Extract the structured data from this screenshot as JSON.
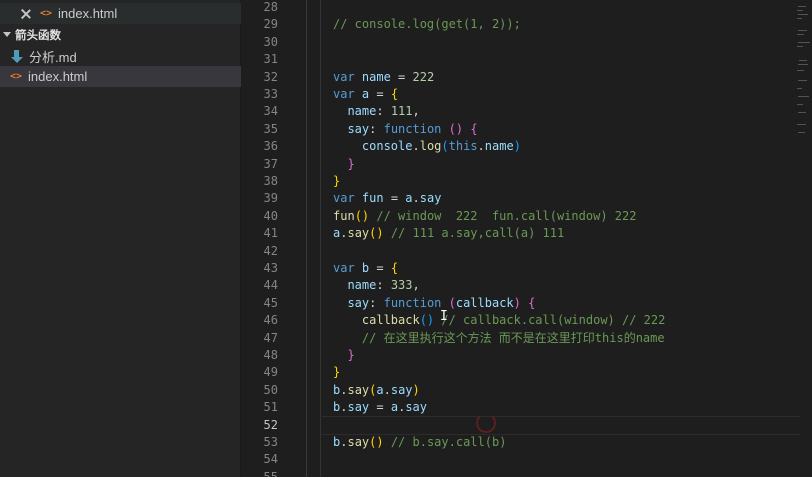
{
  "sidebar": {
    "open_editor": {
      "icon": "html-file-icon",
      "label": "index.html"
    },
    "section": {
      "label": "箭头函数"
    },
    "files": [
      {
        "icon": "markdown-file-icon",
        "label": "分析.md"
      },
      {
        "icon": "html-file-icon",
        "label": "index.html",
        "selected": true
      }
    ]
  },
  "editor": {
    "current_line": 52,
    "line_numbers": [
      "28",
      "29",
      "30",
      "31",
      "32",
      "33",
      "34",
      "35",
      "36",
      "37",
      "38",
      "39",
      "40",
      "41",
      "42",
      "43",
      "44",
      "45",
      "46",
      "47",
      "48",
      "49",
      "50",
      "51",
      "52",
      "53",
      "54",
      "55"
    ],
    "lines": [
      {
        "n": "28",
        "tokens": []
      },
      {
        "n": "29",
        "tokens": [
          {
            "t": "// console.log(get(1, 2));",
            "c": "cm"
          }
        ]
      },
      {
        "n": "30",
        "tokens": []
      },
      {
        "n": "31",
        "tokens": []
      },
      {
        "n": "32",
        "tokens": [
          {
            "t": "var",
            "c": "kw"
          },
          {
            "t": " ",
            "c": "op"
          },
          {
            "t": "name",
            "c": "var"
          },
          {
            "t": " = ",
            "c": "op"
          },
          {
            "t": "222",
            "c": "num"
          }
        ]
      },
      {
        "n": "33",
        "tokens": [
          {
            "t": "var",
            "c": "kw"
          },
          {
            "t": " ",
            "c": "op"
          },
          {
            "t": "a",
            "c": "var"
          },
          {
            "t": " = ",
            "c": "op"
          },
          {
            "t": "{",
            "c": "br1"
          }
        ]
      },
      {
        "n": "34",
        "tokens": [
          {
            "t": "  ",
            "c": "op"
          },
          {
            "t": "name",
            "c": "var"
          },
          {
            "t": ": ",
            "c": "op"
          },
          {
            "t": "111",
            "c": "num"
          },
          {
            "t": ",",
            "c": "op"
          }
        ]
      },
      {
        "n": "35",
        "tokens": [
          {
            "t": "  ",
            "c": "op"
          },
          {
            "t": "say",
            "c": "var"
          },
          {
            "t": ": ",
            "c": "op"
          },
          {
            "t": "function",
            "c": "kw"
          },
          {
            "t": " ",
            "c": "op"
          },
          {
            "t": "()",
            "c": "br2"
          },
          {
            "t": " ",
            "c": "op"
          },
          {
            "t": "{",
            "c": "br2"
          }
        ]
      },
      {
        "n": "36",
        "tokens": [
          {
            "t": "    ",
            "c": "op"
          },
          {
            "t": "console",
            "c": "var"
          },
          {
            "t": ".",
            "c": "op"
          },
          {
            "t": "log",
            "c": "fn"
          },
          {
            "t": "(",
            "c": "br3"
          },
          {
            "t": "this",
            "c": "this"
          },
          {
            "t": ".",
            "c": "op"
          },
          {
            "t": "name",
            "c": "var"
          },
          {
            "t": ")",
            "c": "br3"
          }
        ]
      },
      {
        "n": "37",
        "tokens": [
          {
            "t": "  ",
            "c": "op"
          },
          {
            "t": "}",
            "c": "br2"
          }
        ]
      },
      {
        "n": "38",
        "tokens": [
          {
            "t": "}",
            "c": "br1"
          }
        ]
      },
      {
        "n": "39",
        "tokens": [
          {
            "t": "var",
            "c": "kw"
          },
          {
            "t": " ",
            "c": "op"
          },
          {
            "t": "fun",
            "c": "var"
          },
          {
            "t": " = ",
            "c": "op"
          },
          {
            "t": "a",
            "c": "var"
          },
          {
            "t": ".",
            "c": "op"
          },
          {
            "t": "say",
            "c": "var"
          }
        ]
      },
      {
        "n": "40",
        "tokens": [
          {
            "t": "fun",
            "c": "fn"
          },
          {
            "t": "()",
            "c": "br1"
          },
          {
            "t": " // window  222  fun.call(window) 222",
            "c": "cm"
          }
        ]
      },
      {
        "n": "41",
        "tokens": [
          {
            "t": "a",
            "c": "var"
          },
          {
            "t": ".",
            "c": "op"
          },
          {
            "t": "say",
            "c": "fn"
          },
          {
            "t": "()",
            "c": "br1"
          },
          {
            "t": " // 111 a.say,call(a) 111",
            "c": "cm"
          }
        ]
      },
      {
        "n": "42",
        "tokens": []
      },
      {
        "n": "43",
        "tokens": [
          {
            "t": "var",
            "c": "kw"
          },
          {
            "t": " ",
            "c": "op"
          },
          {
            "t": "b",
            "c": "var"
          },
          {
            "t": " = ",
            "c": "op"
          },
          {
            "t": "{",
            "c": "br1"
          }
        ]
      },
      {
        "n": "44",
        "tokens": [
          {
            "t": "  ",
            "c": "op"
          },
          {
            "t": "name",
            "c": "var"
          },
          {
            "t": ": ",
            "c": "op"
          },
          {
            "t": "333",
            "c": "num"
          },
          {
            "t": ",",
            "c": "op"
          }
        ]
      },
      {
        "n": "45",
        "tokens": [
          {
            "t": "  ",
            "c": "op"
          },
          {
            "t": "say",
            "c": "var"
          },
          {
            "t": ": ",
            "c": "op"
          },
          {
            "t": "function",
            "c": "kw"
          },
          {
            "t": " ",
            "c": "op"
          },
          {
            "t": "(",
            "c": "br2"
          },
          {
            "t": "callback",
            "c": "var"
          },
          {
            "t": ")",
            "c": "br2"
          },
          {
            "t": " ",
            "c": "op"
          },
          {
            "t": "{",
            "c": "br2"
          }
        ]
      },
      {
        "n": "46",
        "tokens": [
          {
            "t": "    ",
            "c": "op"
          },
          {
            "t": "callback",
            "c": "fn"
          },
          {
            "t": "()",
            "c": "br3"
          },
          {
            "t": " // callback.call(window) // 222",
            "c": "cm"
          }
        ]
      },
      {
        "n": "47",
        "tokens": [
          {
            "t": "    ",
            "c": "op"
          },
          {
            "t": "// 在这里执行这个方法 而不是在这里打印this的name",
            "c": "cm"
          }
        ]
      },
      {
        "n": "48",
        "tokens": [
          {
            "t": "  ",
            "c": "op"
          },
          {
            "t": "}",
            "c": "br2"
          }
        ]
      },
      {
        "n": "49",
        "tokens": [
          {
            "t": "}",
            "c": "br1"
          }
        ]
      },
      {
        "n": "50",
        "tokens": [
          {
            "t": "b",
            "c": "var"
          },
          {
            "t": ".",
            "c": "op"
          },
          {
            "t": "say",
            "c": "fn"
          },
          {
            "t": "(",
            "c": "br1"
          },
          {
            "t": "a",
            "c": "var"
          },
          {
            "t": ".",
            "c": "op"
          },
          {
            "t": "say",
            "c": "var"
          },
          {
            "t": ")",
            "c": "br1"
          }
        ]
      },
      {
        "n": "51",
        "tokens": [
          {
            "t": "b",
            "c": "var"
          },
          {
            "t": ".",
            "c": "op"
          },
          {
            "t": "say",
            "c": "var"
          },
          {
            "t": " = ",
            "c": "op"
          },
          {
            "t": "a",
            "c": "var"
          },
          {
            "t": ".",
            "c": "op"
          },
          {
            "t": "say",
            "c": "var"
          }
        ]
      },
      {
        "n": "52",
        "tokens": []
      },
      {
        "n": "53",
        "tokens": [
          {
            "t": "b",
            "c": "var"
          },
          {
            "t": ".",
            "c": "op"
          },
          {
            "t": "say",
            "c": "fn"
          },
          {
            "t": "()",
            "c": "br1"
          },
          {
            "t": " // b.say.call(b)",
            "c": "cm"
          }
        ]
      },
      {
        "n": "54",
        "tokens": []
      },
      {
        "n": "55",
        "tokens": []
      }
    ]
  },
  "colors": {
    "keyword": "#569cd6",
    "variable": "#9cdcfe",
    "number": "#b5cea8",
    "function": "#dcdcaa",
    "comment": "#6a9955",
    "bracket1": "#ffd700",
    "bracket2": "#da70d6",
    "bracket3": "#179fff"
  }
}
